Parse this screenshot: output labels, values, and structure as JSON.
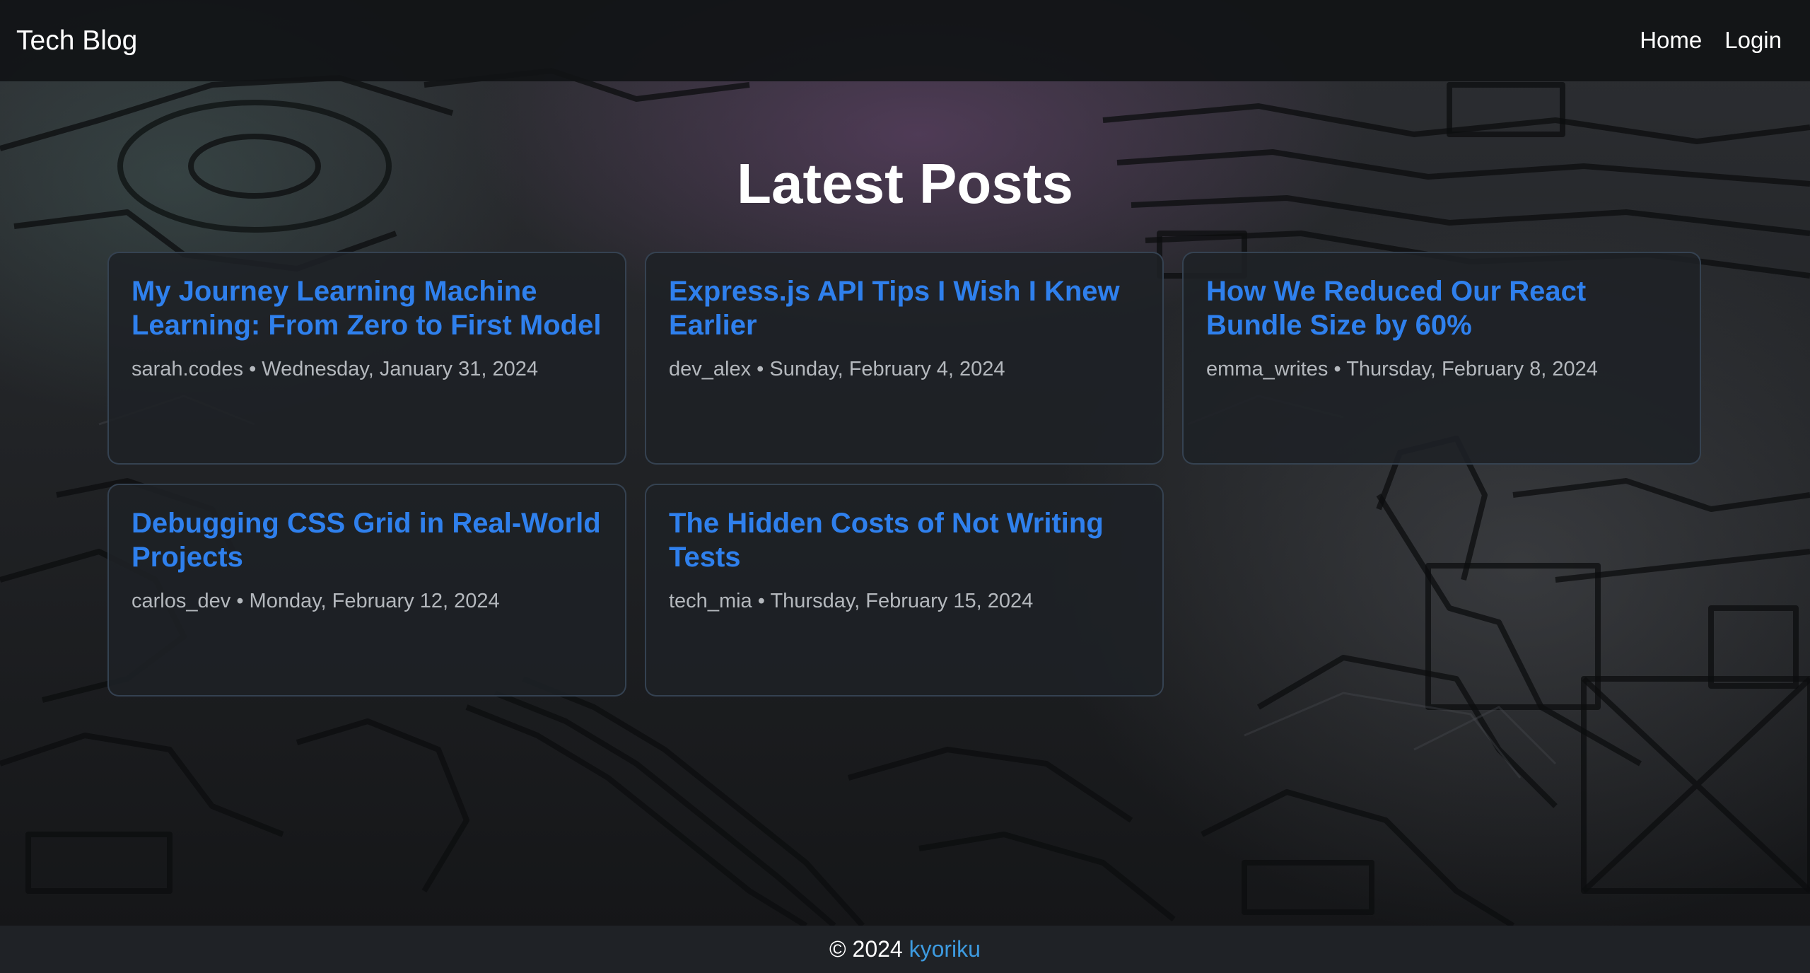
{
  "header": {
    "brand": "Tech Blog",
    "nav": [
      "Home",
      "Login"
    ]
  },
  "main": {
    "title": "Latest Posts",
    "posts": [
      {
        "title": "My Journey Learning Machine Learning: From Zero to First Model",
        "author": "sarah.codes",
        "date": "Wednesday, January 31, 2024"
      },
      {
        "title": "Express.js API Tips I Wish I Knew Earlier",
        "author": "dev_alex",
        "date": "Sunday, February 4, 2024"
      },
      {
        "title": "How We Reduced Our React Bundle Size by 60%",
        "author": "emma_writes",
        "date": "Thursday, February 8, 2024"
      },
      {
        "title": "Debugging CSS Grid in Real-World Projects",
        "author": "carlos_dev",
        "date": "Monday, February 12, 2024"
      },
      {
        "title": "The Hidden Costs of Not Writing Tests",
        "author": "tech_mia",
        "date": "Thursday, February 15, 2024"
      }
    ],
    "meta_separator": "•"
  },
  "footer": {
    "copyright": "© 2024",
    "link": "kyoriku"
  },
  "colors": {
    "accent_link": "#2f80ed",
    "footer_link": "#3d9be0",
    "header_bg": "#111316",
    "card_border": "#3e4e60"
  },
  "background": "circuit-board-image"
}
